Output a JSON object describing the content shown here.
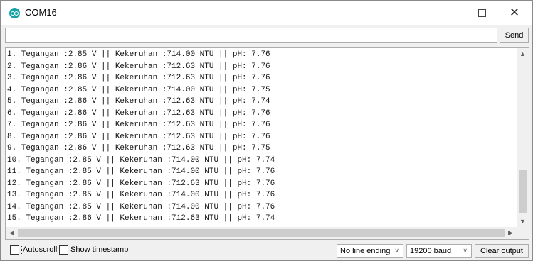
{
  "window": {
    "title": "COM16",
    "minimize_icon": "minimize-icon",
    "maximize_icon": "maximize-icon",
    "close_glyph": "✕"
  },
  "input": {
    "value": "",
    "send_label": "Send"
  },
  "output": {
    "lines": [
      "1. Tegangan :2.85 V || Kekeruhan :714.00 NTU || pH: 7.76",
      "2. Tegangan :2.86 V || Kekeruhan :712.63 NTU || pH: 7.76",
      "3. Tegangan :2.86 V || Kekeruhan :712.63 NTU || pH: 7.76",
      "4. Tegangan :2.85 V || Kekeruhan :714.00 NTU || pH: 7.75",
      "5. Tegangan :2.86 V || Kekeruhan :712.63 NTU || pH: 7.74",
      "6. Tegangan :2.86 V || Kekeruhan :712.63 NTU || pH: 7.76",
      "7. Tegangan :2.86 V || Kekeruhan :712.63 NTU || pH: 7.76",
      "8. Tegangan :2.86 V || Kekeruhan :712.63 NTU || pH: 7.76",
      "9. Tegangan :2.86 V || Kekeruhan :712.63 NTU || pH: 7.75",
      "10. Tegangan :2.85 V || Kekeruhan :714.00 NTU || pH: 7.74",
      "11. Tegangan :2.85 V || Kekeruhan :714.00 NTU || pH: 7.76",
      "12. Tegangan :2.86 V || Kekeruhan :712.63 NTU || pH: 7.76",
      "13. Tegangan :2.85 V || Kekeruhan :714.00 NTU || pH: 7.76",
      "14. Tegangan :2.85 V || Kekeruhan :714.00 NTU || pH: 7.76",
      "15. Tegangan :2.86 V || Kekeruhan :712.63 NTU || pH: 7.74"
    ]
  },
  "bottom": {
    "autoscroll_label": "Autoscroll",
    "autoscroll_checked": false,
    "timestamp_label": "Show timestamp",
    "timestamp_checked": false,
    "line_ending": "No line ending",
    "baud_rate": "19200 baud",
    "clear_label": "Clear output"
  },
  "colors": {
    "app_icon": "#15a3a6",
    "window_bg": "#f0f0f0",
    "scroll_thumb": "#cdcdcd"
  }
}
